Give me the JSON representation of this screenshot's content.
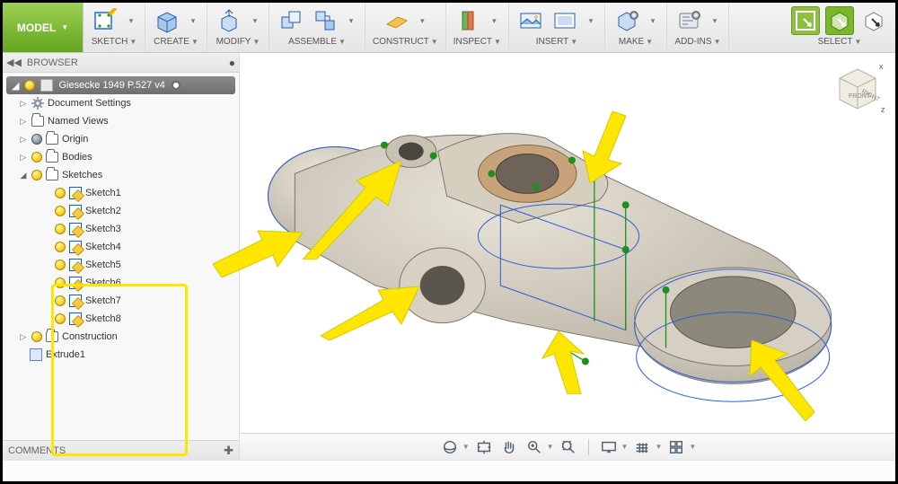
{
  "ribbon": {
    "model_label": "MODEL",
    "groups": [
      {
        "id": "sketch",
        "label": "SKETCH"
      },
      {
        "id": "create",
        "label": "CREATE"
      },
      {
        "id": "modify",
        "label": "MODIFY"
      },
      {
        "id": "assemble",
        "label": "ASSEMBLE"
      },
      {
        "id": "construct",
        "label": "CONSTRUCT"
      },
      {
        "id": "inspect",
        "label": "INSPECT"
      },
      {
        "id": "insert",
        "label": "INSERT"
      },
      {
        "id": "make",
        "label": "MAKE"
      },
      {
        "id": "addins",
        "label": "ADD-INS"
      },
      {
        "id": "select",
        "label": "SELECT"
      }
    ]
  },
  "browser": {
    "title": "BROWSER",
    "document": "Giesecke 1949 P.527 v4",
    "nodes": {
      "doc_settings": "Document Settings",
      "named_views": "Named Views",
      "origin": "Origin",
      "bodies": "Bodies",
      "sketches": "Sketches",
      "sketch_items": [
        "Sketch1",
        "Sketch2",
        "Sketch3",
        "Sketch4",
        "Sketch5",
        "Sketch6",
        "Sketch7",
        "Sketch8"
      ],
      "construction": "Construction",
      "extrude": "Extrude1"
    }
  },
  "comments": {
    "label": "COMMENTS"
  },
  "viewcube": {
    "front": "FRONT",
    "right": "RIGHT"
  },
  "axes": {
    "x": "x",
    "z": "z"
  }
}
